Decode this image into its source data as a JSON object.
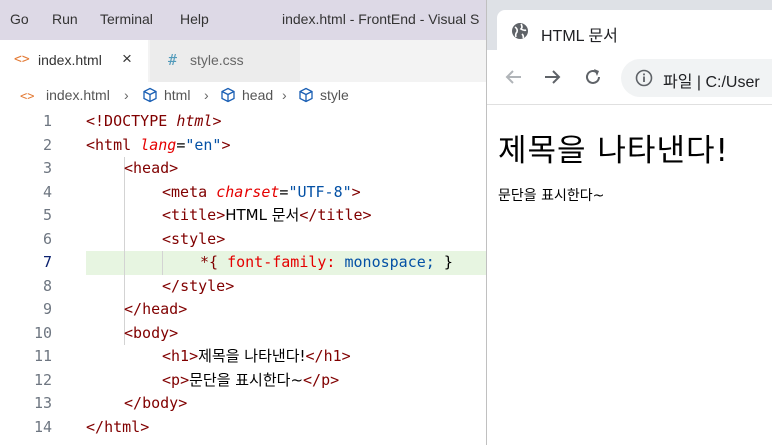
{
  "vscode": {
    "menu": [
      "Go",
      "Run",
      "Terminal",
      "Help"
    ],
    "window_title": "index.html - FrontEnd - Visual S",
    "tabs": [
      {
        "icon": "<>",
        "label": "index.html",
        "close": "×"
      },
      {
        "icon": "#",
        "label": "style.css"
      }
    ],
    "breadcrumb": [
      "index.html",
      "html",
      "head",
      "style"
    ],
    "active_line": 7,
    "line_numbers": [
      "1",
      "2",
      "3",
      "4",
      "5",
      "6",
      "7",
      "8",
      "9",
      "10",
      "11",
      "12",
      "13",
      "14"
    ],
    "code": {
      "l1_open": "<!DOCTYPE",
      "l1_kw": "html",
      "l1_close": ">",
      "l2_tag": "html",
      "l2_attr": "lang",
      "l2_val": "\"en\"",
      "l3_tag": "head",
      "l4_tag": "meta",
      "l4_attr": "charset",
      "l4_val": "\"UTF-8\"",
      "l5_tag": "title",
      "l5_text": "HTML 문서",
      "l6_tag": "style",
      "l7_selector": "*{",
      "l7_prop": "font-family:",
      "l7_val": "monospace;",
      "l7_end": "}",
      "l8_tag": "style",
      "l9_tag": "head",
      "l10_tag": "body",
      "l11_tag": "h1",
      "l11_text": "제목을 나타낸다!",
      "l12_tag": "p",
      "l12_text": "문단을 표시한다~",
      "l13_tag": "body",
      "l14_tag": "html"
    }
  },
  "chrome": {
    "tab_title": "HTML 문서",
    "tab_close": "×",
    "omnibox": "파일 | C:/User",
    "page": {
      "h1": "제목을 나타낸다!",
      "p": "문단을 표시한다~"
    }
  },
  "colors": {
    "menubar_bg": "#ddd9e6",
    "active_line_bg": "#e7f5e1",
    "tag": "#800000",
    "attr": "#e50000",
    "string": "#0451a5"
  }
}
